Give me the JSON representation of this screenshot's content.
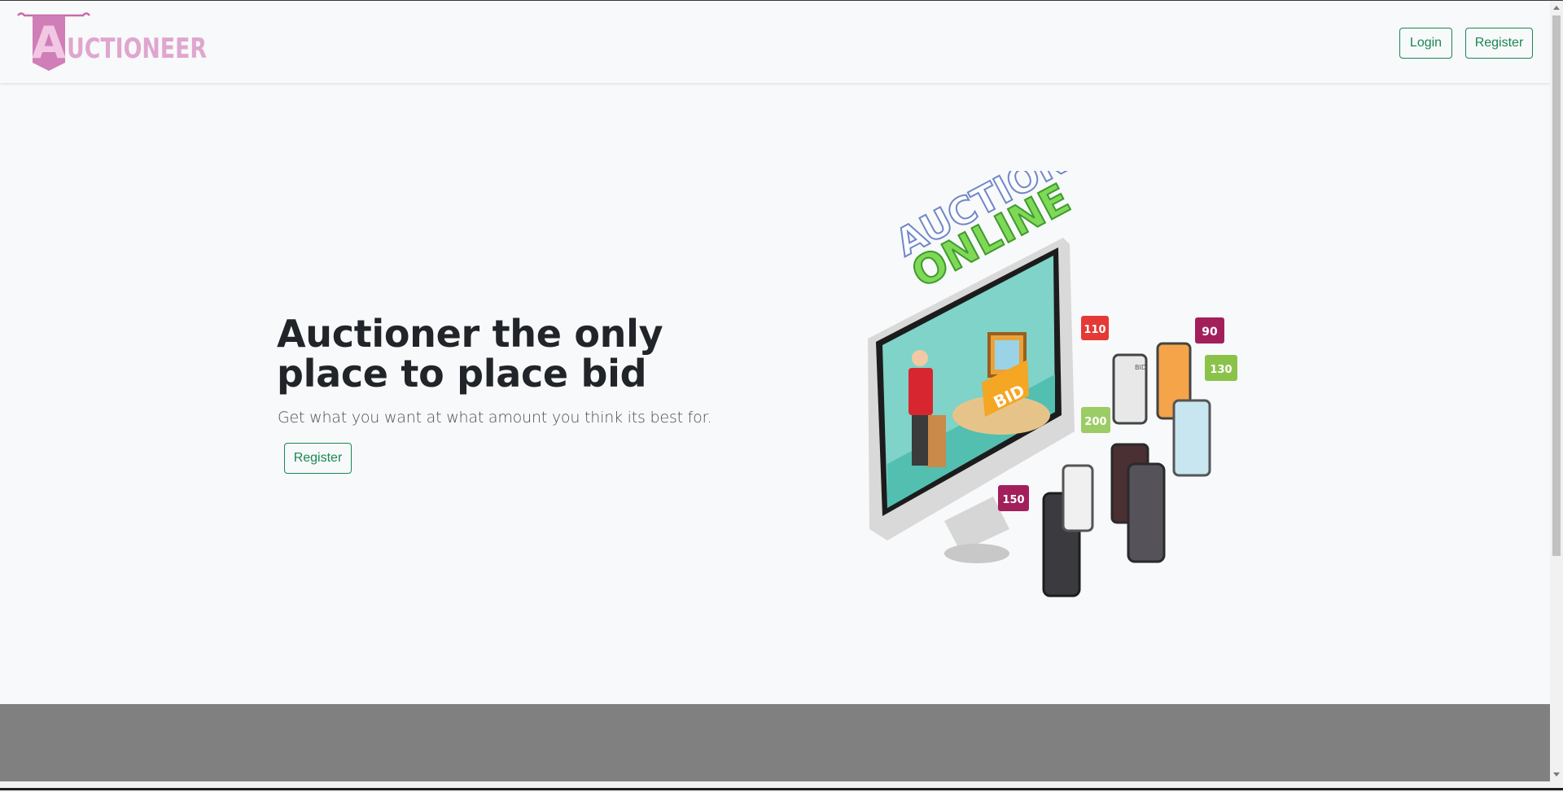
{
  "brand": {
    "name": "AUCTIONEER",
    "initial": "A",
    "rest": "UCTIONEER"
  },
  "nav": {
    "login_label": "Login",
    "register_label": "Register"
  },
  "hero": {
    "title": "Auctioner the only place to place bid",
    "subtitle": "Get what you want at what amount you think its best for.",
    "register_label": "Register"
  },
  "illustration": {
    "headline_top": "AUCTION",
    "headline_bottom": "ONLINE",
    "podium_sign": "BID",
    "bubbles": [
      "110",
      "90",
      "130",
      "200",
      "150"
    ],
    "phone_tag": "BID"
  },
  "colors": {
    "accent": "#198754",
    "logo": "#d58bc0",
    "footer": "#808080",
    "background": "#f8f9fa"
  }
}
